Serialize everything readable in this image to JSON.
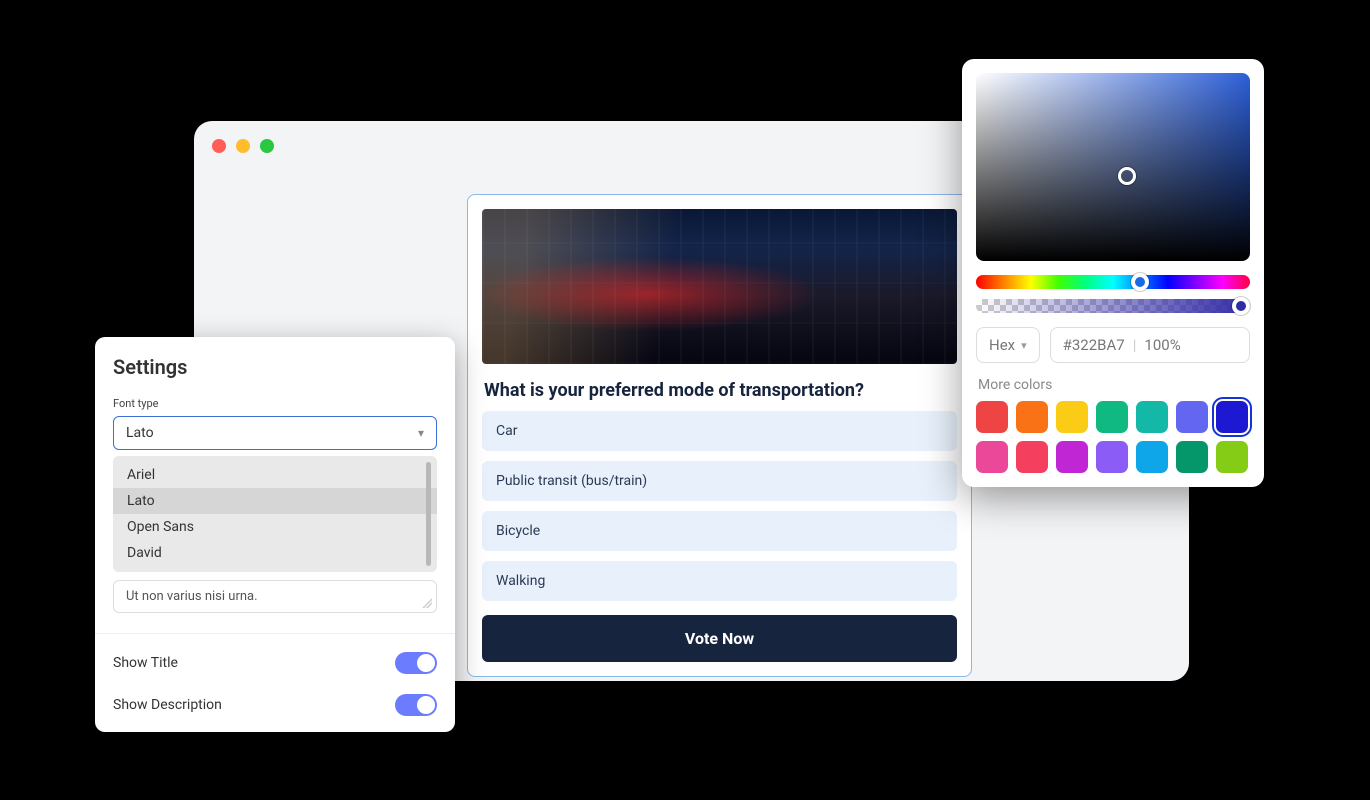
{
  "settings": {
    "title": "Settings",
    "font_type_label": "Font type",
    "font_selected": "Lato",
    "font_options": [
      "Ariel",
      "Lato",
      "Open Sans",
      "David"
    ],
    "description_value": "Ut non varius nisi urna.",
    "show_title_label": "Show Title",
    "show_description_label": "Show Description"
  },
  "poll": {
    "question": "What is your preferred mode of transportation?",
    "options": [
      "Car",
      "Public transit (bus/train)",
      "Bicycle",
      "Walking"
    ],
    "button": "Vote Now"
  },
  "picker": {
    "mode": "Hex",
    "hex": "#322BA7",
    "opacity": "100%",
    "more_label": "More colors",
    "swatches": [
      "#ef4444",
      "#f97316",
      "#facc15",
      "#10b981",
      "#14b8a6",
      "#6366f1",
      "#1d19d3",
      "#ec4899",
      "#f43f5e",
      "#c026d3",
      "#8b5cf6",
      "#0ea5e9",
      "#059669",
      "#84cc16"
    ],
    "selected_swatch_index": 6
  }
}
